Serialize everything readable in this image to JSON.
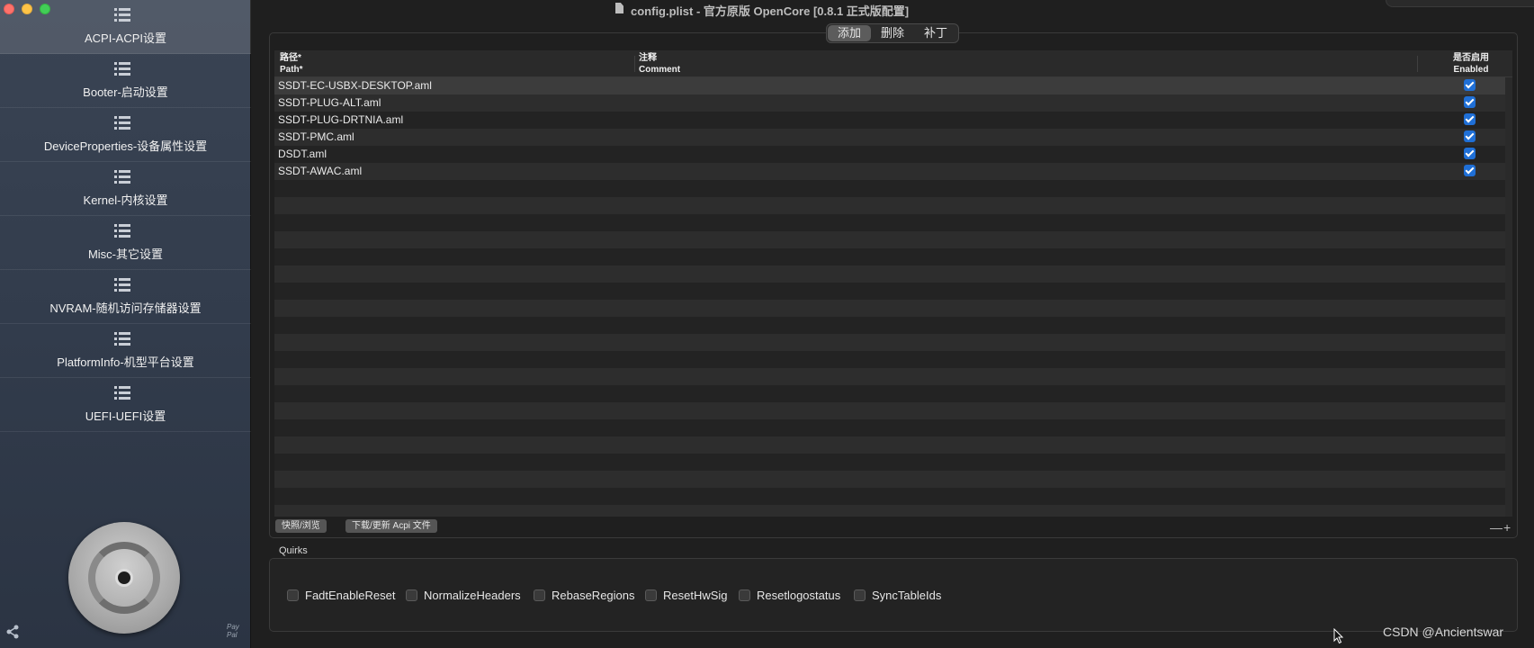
{
  "window": {
    "title": "config.plist - 官方原版 OpenCore [0.8.1 正式版配置]"
  },
  "sidebar": {
    "items": [
      {
        "label": "ACPI-ACPI设置",
        "active": true
      },
      {
        "label": "Booter-启动设置"
      },
      {
        "label": "DeviceProperties-设备属性设置"
      },
      {
        "label": "Kernel-内核设置"
      },
      {
        "label": "Misc-其它设置"
      },
      {
        "label": "NVRAM-随机访问存储器设置"
      },
      {
        "label": "PlatformInfo-机型平台设置"
      },
      {
        "label": "UEFI-UEFI设置"
      }
    ],
    "paypal_text": "Pay Pal"
  },
  "segments": [
    "添加",
    "删除",
    "补丁"
  ],
  "table": {
    "headers": {
      "path_cn": "路径*",
      "path_en": "Path*",
      "comment_cn": "注释",
      "comment_en": "Comment",
      "enabled_cn": "是否启用",
      "enabled_en": "Enabled"
    },
    "rows": [
      {
        "path": "SSDT-EC-USBX-DESKTOP.aml",
        "comment": "",
        "enabled": true
      },
      {
        "path": "SSDT-PLUG-ALT.aml",
        "comment": "",
        "enabled": true
      },
      {
        "path": "SSDT-PLUG-DRTNIA.aml",
        "comment": "",
        "enabled": true
      },
      {
        "path": "SSDT-PMC.aml",
        "comment": "",
        "enabled": true
      },
      {
        "path": "DSDT.aml",
        "comment": "",
        "enabled": true
      },
      {
        "path": "SSDT-AWAC.aml",
        "comment": "",
        "enabled": true
      }
    ]
  },
  "buttons": {
    "snapshot": "快照/浏览",
    "download": "下载/更新 Acpi 文件",
    "minus_plus": "—+"
  },
  "quirks": {
    "label": "Quirks",
    "items": [
      {
        "label": "FadtEnableReset",
        "checked": false
      },
      {
        "label": "NormalizeHeaders",
        "checked": false
      },
      {
        "label": "RebaseRegions",
        "checked": false
      },
      {
        "label": "ResetHwSig",
        "checked": false
      },
      {
        "label": "Resetlogostatus",
        "checked": false
      },
      {
        "label": "SyncTableIds",
        "checked": false
      }
    ]
  },
  "watermark": "CSDN @Ancientswar",
  "colors": {
    "accent": "#1f6fd6",
    "sidebar": "#323c4c",
    "background": "#1f1f1f"
  }
}
